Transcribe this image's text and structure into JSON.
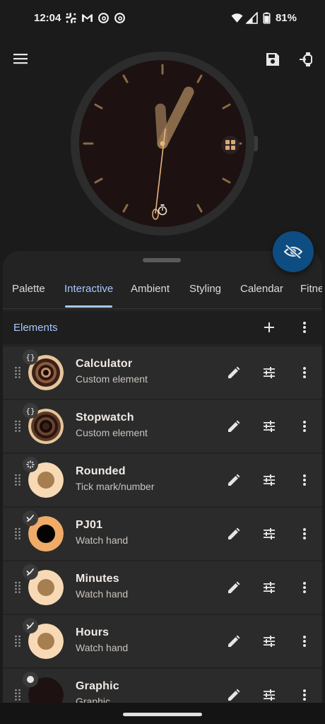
{
  "status_bar": {
    "time": "12:04",
    "battery": "81%",
    "left_icons": [
      "slack-icon",
      "gmail-icon",
      "threads-icon",
      "threads-icon"
    ],
    "right_icons": [
      "wifi-icon",
      "signal-icon",
      "battery-icon"
    ]
  },
  "colors": {
    "accent": "#a6c8ff",
    "fab": "#0e4d82",
    "watch_bg": "#1d1211",
    "hand_color": "#9a7a55",
    "second_hand": "#e8b47a"
  },
  "tabs": [
    {
      "label": "Palette",
      "active": false
    },
    {
      "label": "Interactive",
      "active": true
    },
    {
      "label": "Ambient",
      "active": false
    },
    {
      "label": "Styling",
      "active": false
    },
    {
      "label": "Calendar",
      "active": false
    },
    {
      "label": "Fitne",
      "active": false
    }
  ],
  "elements_header": {
    "title": "Elements"
  },
  "elements": [
    {
      "title": "Calculator",
      "subtitle": "Custom element",
      "badge": "{}",
      "thumb": "ring-dark"
    },
    {
      "title": "Stopwatch",
      "subtitle": "Custom element",
      "badge": "{}",
      "thumb": "ring-dark"
    },
    {
      "title": "Rounded",
      "subtitle": "Tick mark/number",
      "badge": "tick-icon",
      "thumb": "peach"
    },
    {
      "title": "PJ01",
      "subtitle": "Watch hand",
      "badge": "hand-icon",
      "thumb": "orange-black"
    },
    {
      "title": "Minutes",
      "subtitle": "Watch hand",
      "badge": "hand-icon",
      "thumb": "peach"
    },
    {
      "title": "Hours",
      "subtitle": "Watch hand",
      "badge": "hand-icon",
      "thumb": "peach"
    },
    {
      "title": "Graphic",
      "subtitle": "Graphic",
      "badge": "dot-icon",
      "thumb": "dark"
    }
  ]
}
